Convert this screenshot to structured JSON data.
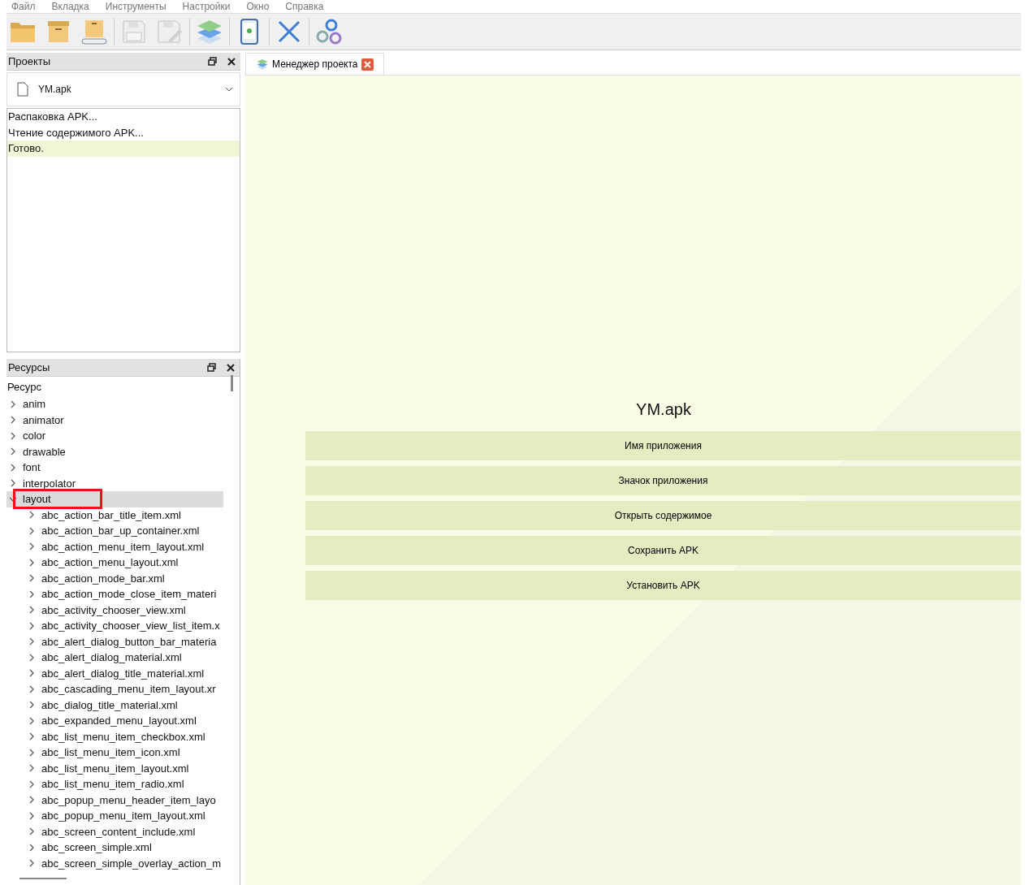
{
  "menu": [
    "Файл",
    "Вкладка",
    "Инструменты",
    "Настройки",
    "Окно",
    "Справка"
  ],
  "toolbar": [
    {
      "kind": "folder",
      "disabled": false
    },
    {
      "kind": "box",
      "disabled": false
    },
    {
      "kind": "conveyor",
      "disabled": false
    },
    {
      "kind": "save",
      "disabled": true
    },
    {
      "kind": "save-as",
      "disabled": true
    },
    {
      "kind": "layers",
      "disabled": false
    },
    {
      "kind": "phone",
      "disabled": false
    },
    {
      "kind": "cross",
      "disabled": false
    },
    {
      "kind": "gears",
      "disabled": false
    }
  ],
  "projects_panel": {
    "title": "Проекты",
    "project_select": {
      "value": "YM.apk"
    },
    "log": [
      {
        "text": "Распаковка APK...",
        "selected": false
      },
      {
        "text": "Чтение содержимого APK...",
        "selected": false
      },
      {
        "text": "Готово.",
        "selected": true
      }
    ]
  },
  "resources_panel": {
    "title": "Ресурсы",
    "column_header": "Ресурс",
    "tree": [
      {
        "label": "anim",
        "expanded": false,
        "selected": false,
        "marked": false
      },
      {
        "label": "animator",
        "expanded": false,
        "selected": false,
        "marked": false
      },
      {
        "label": "color",
        "expanded": false,
        "selected": false,
        "marked": false
      },
      {
        "label": "drawable",
        "expanded": false,
        "selected": false,
        "marked": false
      },
      {
        "label": "font",
        "expanded": false,
        "selected": false,
        "marked": false
      },
      {
        "label": "interpolator",
        "expanded": false,
        "selected": false,
        "marked": false
      },
      {
        "label": "layout",
        "expanded": true,
        "selected": true,
        "marked": true,
        "children": [
          {
            "label": "abc_action_bar_title_item.xml"
          },
          {
            "label": "abc_action_bar_up_container.xml"
          },
          {
            "label": "abc_action_menu_item_layout.xml"
          },
          {
            "label": "abc_action_menu_layout.xml"
          },
          {
            "label": "abc_action_mode_bar.xml"
          },
          {
            "label": "abc_action_mode_close_item_materi"
          },
          {
            "label": "abc_activity_chooser_view.xml"
          },
          {
            "label": "abc_activity_chooser_view_list_item.x"
          },
          {
            "label": "abc_alert_dialog_button_bar_materia"
          },
          {
            "label": "abc_alert_dialog_material.xml"
          },
          {
            "label": "abc_alert_dialog_title_material.xml"
          },
          {
            "label": "abc_cascading_menu_item_layout.xr"
          },
          {
            "label": "abc_dialog_title_material.xml"
          },
          {
            "label": "abc_expanded_menu_layout.xml"
          },
          {
            "label": "abc_list_menu_item_checkbox.xml"
          },
          {
            "label": "abc_list_menu_item_icon.xml"
          },
          {
            "label": "abc_list_menu_item_layout.xml"
          },
          {
            "label": "abc_list_menu_item_radio.xml"
          },
          {
            "label": "abc_popup_menu_header_item_layo"
          },
          {
            "label": "abc_popup_menu_item_layout.xml"
          },
          {
            "label": "abc_screen_content_include.xml"
          },
          {
            "label": "abc_screen_simple.xml"
          },
          {
            "label": "abc_screen_simple_overlay_action_m"
          }
        ]
      }
    ]
  },
  "tabs": [
    {
      "label": "Менеджер проекта",
      "selected": true
    }
  ],
  "project_manager": {
    "title": "YM.apk",
    "actions": [
      "Имя приложения",
      "Значок приложения",
      "Открыть содержимое",
      "Сохранить APK",
      "Установить APK"
    ]
  }
}
